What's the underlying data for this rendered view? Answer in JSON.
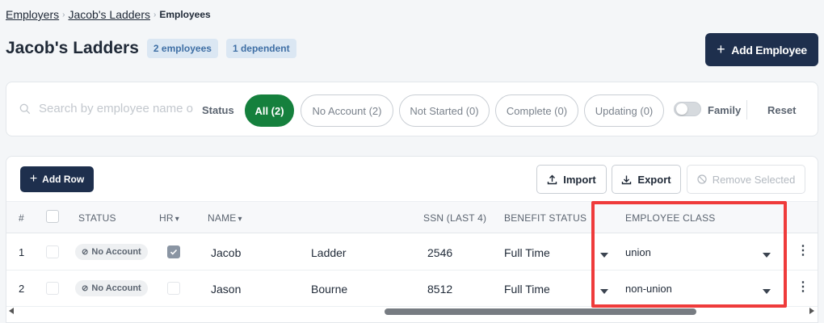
{
  "breadcrumb": {
    "items": [
      "Employers",
      "Jacob's Ladders"
    ],
    "current": "Employees"
  },
  "header": {
    "title": "Jacob's Ladders",
    "badges": [
      "2 employees",
      "1 dependent"
    ],
    "add_employee_label": "Add Employee"
  },
  "filters": {
    "search_placeholder": "Search by employee name o",
    "status_label": "Status",
    "pills": [
      "All (2)",
      "No Account (2)",
      "Not Started (0)",
      "Complete (0)",
      "Updating (0)"
    ],
    "active_pill": "All (2)",
    "family_label": "Family",
    "family_toggle_on": false,
    "reset_label": "Reset"
  },
  "toolbar": {
    "add_row_label": "Add Row",
    "import_label": "Import",
    "export_label": "Export",
    "remove_selected_label": "Remove Selected"
  },
  "table": {
    "columns": {
      "index": "#",
      "status": "STATUS",
      "hr": "HR",
      "name": "NAME",
      "ssn": "SSN (LAST 4)",
      "benefit_status": "BENEFIT STATUS",
      "employee_class": "EMPLOYEE CLASS"
    },
    "rows": [
      {
        "index": "1",
        "status": "No Account",
        "hr": true,
        "first": "Jacob",
        "last": "Ladder",
        "ssn": "2546",
        "benefit_status": "Full Time",
        "employee_class": "union"
      },
      {
        "index": "2",
        "status": "No Account",
        "hr": false,
        "first": "Jason",
        "last": "Bourne",
        "ssn": "8512",
        "benefit_status": "Full Time",
        "employee_class": "non-union"
      }
    ]
  },
  "colors": {
    "primary": "#1e2f4d",
    "active_green": "#15803d",
    "highlight_red": "#ef3b3b",
    "badge_bg": "#dbe7f3"
  }
}
